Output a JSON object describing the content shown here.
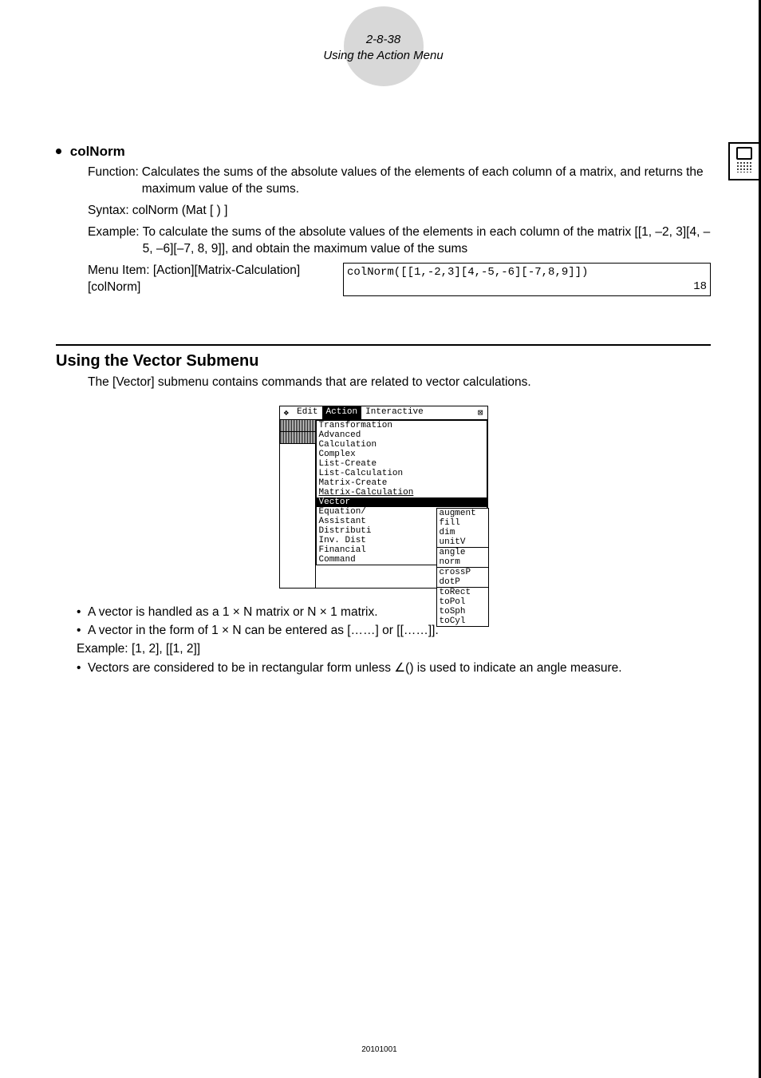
{
  "header": {
    "page_ref": "2-8-38",
    "title": "Using the Action Menu"
  },
  "colNorm": {
    "name": "colNorm",
    "function_label": "Function:",
    "function_text": "Calculates the sums of the absolute values of the elements of each column of a matrix, and returns the maximum value of the sums.",
    "syntax_label": "Syntax:",
    "syntax_text": "colNorm (Mat [ ) ]",
    "example_label": "Example:",
    "example_text": "To calculate the sums of the absolute values of the elements in each column of the matrix [[1, –2, 3][4, –5, –6][–7, 8, 9]], and obtain the maximum value of the sums",
    "menu_label": "Menu Item:",
    "menu_text": "[Action][Matrix-Calculation] [colNorm]",
    "calc_input": "colNorm([[1,-2,3][4,-5,-6][-7,8,9]])",
    "calc_result": "18"
  },
  "section": {
    "heading": "Using the Vector Submenu",
    "intro": "The [Vector] submenu contains commands that are related to vector calculations."
  },
  "screenshot": {
    "menubar": {
      "edit": "Edit",
      "action": "Action",
      "interactive": "Interactive"
    },
    "action_menu": [
      "Transformation",
      "Advanced",
      "Calculation",
      "Complex",
      "List-Create",
      "List-Calculation",
      "Matrix-Create",
      "Matrix-Calculation",
      "Vector",
      "Equation/",
      "Assistant",
      "Distributi",
      "Inv. Dist",
      "Financial",
      "Command"
    ],
    "vector_submenu": {
      "g1": [
        "augment",
        "fill",
        "dim",
        "unitV"
      ],
      "g2": [
        "angle",
        "norm"
      ],
      "g3": [
        "crossP",
        "dotP"
      ],
      "g4": [
        "toRect",
        "toPol",
        "toSph",
        "toCyl"
      ]
    }
  },
  "notes": {
    "n1": "A vector is handled as a 1 × N matrix or N × 1 matrix.",
    "n2": "A vector in the form of 1 × N can be entered as [……] or [[……]].",
    "ex_label": "Example:",
    "ex_text": "[1, 2], [[1, 2]]",
    "n3_pre": "Vectors are considered to be in rectangular form unless ",
    "n3_angle": "∠",
    "n3_post": "() is used to indicate an angle measure."
  },
  "footer": "20101001"
}
